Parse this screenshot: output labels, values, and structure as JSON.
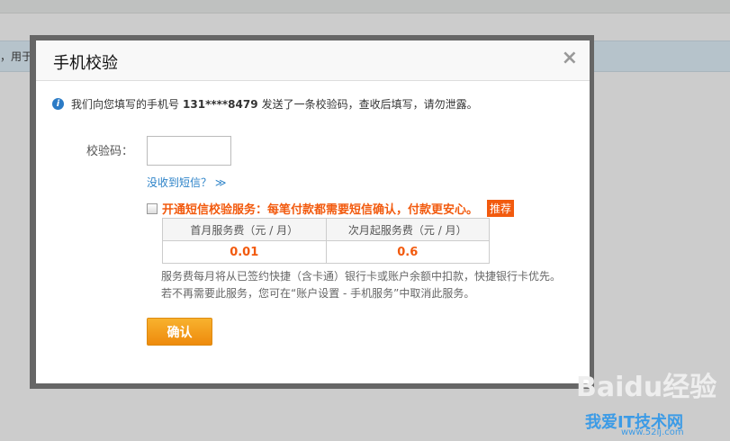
{
  "background": {
    "notice_text": "，用于"
  },
  "dialog": {
    "title": "手机校验",
    "close_label": "×",
    "info": {
      "prefix": "我们向您填写的手机号",
      "phone": "131****8479",
      "suffix": "发送了一条校验码，查收后填写，请勿泄露。"
    },
    "code_label": "校验码：",
    "code_value": "",
    "no_sms_link": "没收到短信？ ≫",
    "sms_service": {
      "label": "开通短信校验服务：每笔付款都需要短信确认，付款更安心。",
      "badge": "推荐",
      "checked": false
    },
    "fee_table": {
      "headers": [
        "首月服务费（元 / 月）",
        "次月起服务费（元 / 月）"
      ],
      "values": [
        "0.01",
        "0.6"
      ]
    },
    "notes": [
      "服务费每月将从已签约快捷（含卡通）银行卡或账户余额中扣款，快捷银行卡优先。",
      "若不再需要此服务，您可在“账户设置 - 手机服务”中取消此服务。"
    ],
    "confirm_label": "确认"
  },
  "watermark": {
    "brand": "Baidu经验",
    "site": "我爱IT技术网",
    "url": "www.52ij.com"
  }
}
